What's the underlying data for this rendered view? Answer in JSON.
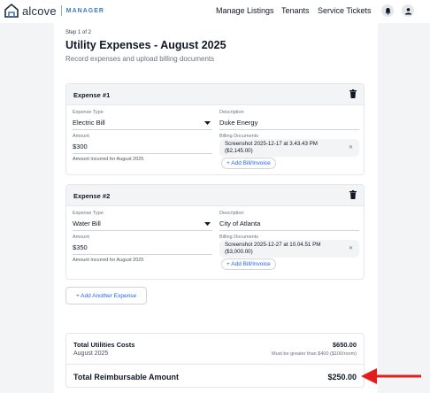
{
  "nav": {
    "brand": "alcove",
    "brand_sub": "MANAGER",
    "links": [
      "Manage Listings",
      "Tenants",
      "Service Tickets"
    ]
  },
  "page": {
    "step": "Step 1 of 2",
    "title": "Utility Expenses - August 2025",
    "subtitle": "Record expenses and upload billing documents"
  },
  "labels": {
    "expense_type": "Expense Type",
    "description": "Description",
    "amount": "Amount",
    "billing_documents": "Billing Documents",
    "add_bill": "+ Add Bill/Invoice",
    "add_expense": "+ Add Another Expense"
  },
  "expenses": [
    {
      "title": "Expense #1",
      "type": "Electric Bill",
      "description": "Duke Energy",
      "amount": "$300",
      "hint": "Amount incurred for August 2025",
      "doc_line1": "Screenshot 2025-12-17 at 3.43.43 PM",
      "doc_line2": "($2,145.00)"
    },
    {
      "title": "Expense #2",
      "type": "Water Bill",
      "description": "City of Atlanta",
      "amount": "$350",
      "hint": "Amount incurred for August 2025",
      "doc_line1": "Screenshot 2025-12-27 at 10.04.51 PM",
      "doc_line2": "($3,000.00)"
    }
  ],
  "summary": {
    "total_label": "Total Utilities Costs",
    "total_value": "$650.00",
    "period": "August 2025",
    "note": "Must be greater than $400 ($100/room)",
    "reimb_label": "Total Reimbursable Amount",
    "reimb_value": "$250.00"
  },
  "colors": {
    "accent": "#2563eb",
    "arrow": "#e11d1d",
    "brand": "#3e7bbf"
  },
  "icons": {
    "logo": "house-logo-icon",
    "bell": "bell-icon",
    "user": "user-icon",
    "trash": "trash-icon",
    "chevron": "chevron-down-icon",
    "remove": "close-icon",
    "arrow": "arrow-left-icon"
  }
}
